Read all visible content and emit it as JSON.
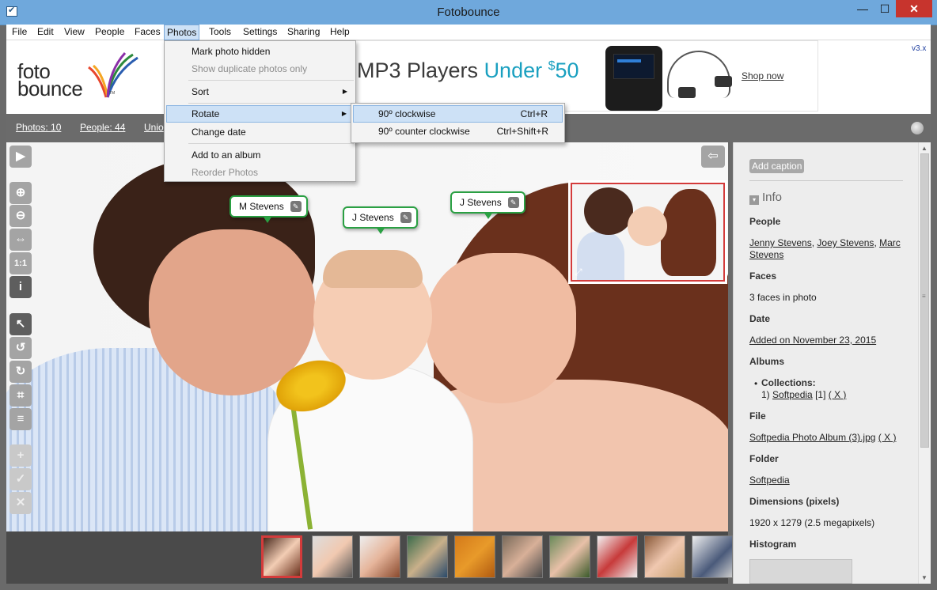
{
  "window": {
    "title": "Fotobounce",
    "min": "—",
    "max": "☐",
    "close": "✕"
  },
  "menu": [
    "File",
    "Edit",
    "View",
    "People",
    "Faces",
    "Photos",
    "Tools",
    "Settings",
    "Sharing",
    "Help"
  ],
  "banner": {
    "logo_line1": "foto",
    "logo_line2": "bounce",
    "logo_tm": "TM",
    "ad_text_prefix": "MP3 Players ",
    "ad_text_highlight": "Under ",
    "ad_price_currency": "$",
    "ad_price": "50",
    "ad_link": "Shop now",
    "version": "v3.x"
  },
  "nav": {
    "photos": "Photos: 10",
    "people": "People: 44",
    "other": "Unio"
  },
  "photos_menu": {
    "items": [
      {
        "label": "Mark photo hidden",
        "disabled": false
      },
      {
        "label": "Show duplicate photos only",
        "disabled": true
      },
      {
        "label": "Sort",
        "submenu": true
      },
      {
        "label": "Rotate",
        "submenu": true,
        "active": true
      },
      {
        "label": "Change date"
      },
      {
        "label": "Add to an album"
      },
      {
        "label": "Reorder Photos",
        "disabled": true
      }
    ]
  },
  "rotate_menu": {
    "items": [
      {
        "label": "90º clockwise",
        "shortcut": "Ctrl+R"
      },
      {
        "label": "90º counter clockwise",
        "shortcut": "Ctrl+Shift+R"
      }
    ]
  },
  "face_tags": [
    "M Stevens",
    "J Stevens",
    "J Stevens"
  ],
  "toolbar_icons": [
    "play-icon",
    "zoom-in-icon",
    "zoom-out-icon",
    "fit-icon",
    "actual-size-icon",
    "info-icon",
    "select-icon",
    "rotate-ccw-icon",
    "rotate-cw-icon",
    "crop-icon",
    "adjust-icon",
    "add-icon",
    "accept-icon",
    "reject-icon"
  ],
  "toolbar_glyphs": {
    "play": "▶",
    "zoom_in": "⊕",
    "zoom_out": "⊖",
    "fit": "⇔",
    "actual": "1:1",
    "info": "i",
    "select": "↖",
    "rot_ccw": "↺",
    "rot_cw": "↻",
    "crop": "⌗",
    "adjust": "≡",
    "add": "+",
    "accept": "✓",
    "reject": "✕"
  },
  "panel": {
    "caption_button": "Add caption",
    "info_heading": "Info",
    "people_label": "People",
    "people": [
      "Jenny Stevens",
      "Joey Stevens",
      "Marc Stevens"
    ],
    "faces_label": "Faces",
    "faces_value": "3 faces in photo",
    "date_label": "Date",
    "date_value": "Added on November 23, 2015",
    "albums_label": "Albums",
    "collections_label": "Collections:",
    "collection_num": "1)",
    "collection_name": "Softpedia",
    "collection_count": "[1]",
    "collection_remove": "( X )",
    "file_label": "File",
    "file_value": "Softpedia Photo Album (3).jpg",
    "file_remove": "( X )",
    "folder_label": "Folder",
    "folder_value": "Softpedia",
    "dimensions_label": "Dimensions (pixels)",
    "dimensions_value": "1920 x 1279 (2.5 megapixels)",
    "histogram_label": "Histogram"
  },
  "filmstrip_count": 10,
  "colors": {
    "titlebar": "#6fa8dc",
    "accent": "#1aa0c0",
    "facetag_border": "#2aa043",
    "selected": "#d43b3b"
  }
}
